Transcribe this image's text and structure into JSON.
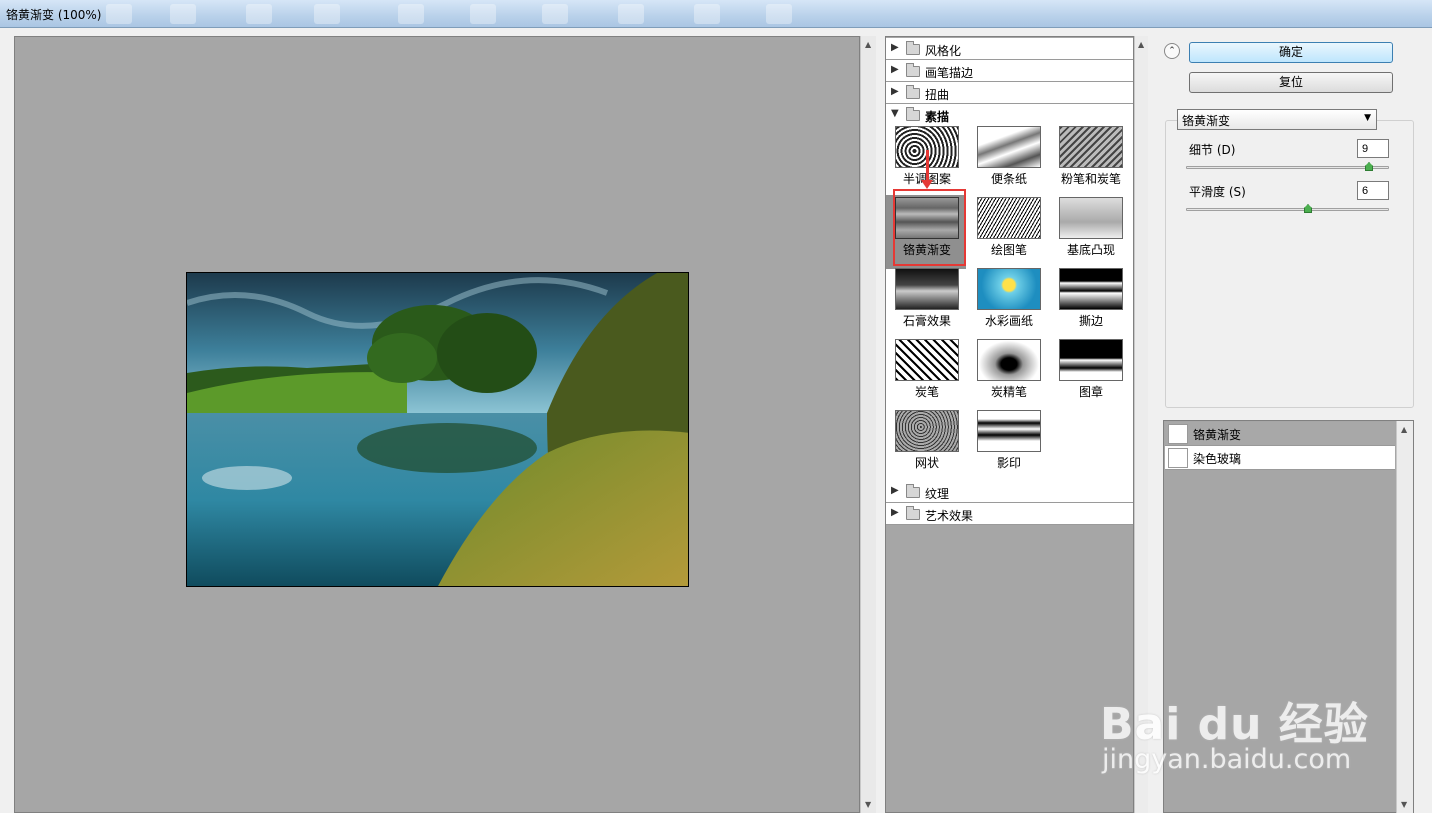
{
  "window": {
    "title": "铬黄渐变 (100%)"
  },
  "gallery": {
    "categories_top": [
      {
        "label": "风格化",
        "state": "collapsed"
      },
      {
        "label": "画笔描边",
        "state": "collapsed"
      },
      {
        "label": "扭曲",
        "state": "collapsed"
      },
      {
        "label": "素描",
        "state": "expanded"
      }
    ],
    "thumbnails": [
      {
        "label": "半调图案"
      },
      {
        "label": "便条纸"
      },
      {
        "label": "粉笔和炭笔"
      },
      {
        "label": "铬黄渐变",
        "selected": true
      },
      {
        "label": "绘图笔"
      },
      {
        "label": "基底凸现"
      },
      {
        "label": "石膏效果"
      },
      {
        "label": "水彩画纸"
      },
      {
        "label": "撕边"
      },
      {
        "label": "炭笔"
      },
      {
        "label": "炭精笔"
      },
      {
        "label": "图章"
      },
      {
        "label": "网状"
      },
      {
        "label": "影印"
      }
    ],
    "categories_bottom": [
      {
        "label": "纹理",
        "state": "collapsed"
      },
      {
        "label": "艺术效果",
        "state": "collapsed"
      }
    ]
  },
  "buttons": {
    "ok": "确定",
    "reset": "复位"
  },
  "filter_select": {
    "value": "铬黄渐变"
  },
  "params": [
    {
      "label": "细节 (D)",
      "value": "9",
      "level": 0.9
    },
    {
      "label": "平滑度 (S)",
      "value": "6",
      "level": 0.6
    }
  ],
  "layers": [
    {
      "name": "铬黄渐变",
      "active": true
    },
    {
      "name": "染色玻璃",
      "active": false
    }
  ],
  "watermark": {
    "main": "Bai du 经验",
    "sub": "jingyan.baidu.com"
  },
  "colors": {
    "highlight": "#e53935",
    "accent_slider": "#4caf50"
  }
}
